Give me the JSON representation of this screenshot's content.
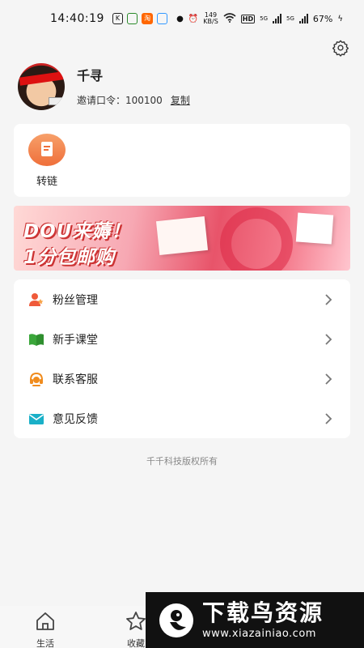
{
  "status_bar": {
    "time": "14:40:19",
    "net_speed": "149",
    "net_unit": "KB/S",
    "hd": "HD",
    "sim1": "5G",
    "sim2": "5G",
    "battery": "67%"
  },
  "profile": {
    "username": "千寻",
    "invite_label": "邀请口令：100100",
    "copy_label": "复制"
  },
  "tools": [
    {
      "label": "转链",
      "icon": "document-icon",
      "color": "#ef6f3a"
    }
  ],
  "banner": {
    "line1": "DOU来薅！",
    "line2": "1分包邮购"
  },
  "menu": [
    {
      "label": "粉丝管理",
      "icon": "fans-icon",
      "color": "#ef5a3a"
    },
    {
      "label": "新手课堂",
      "icon": "book-icon",
      "color": "#3aa63a"
    },
    {
      "label": "联系客服",
      "icon": "headset-icon",
      "color": "#f08c1e"
    },
    {
      "label": "意见反馈",
      "icon": "mail-icon",
      "color": "#1ab0c8"
    }
  ],
  "copyright": "千千科技版权所有",
  "tabbar": [
    {
      "label": "生活",
      "icon": "home-icon"
    },
    {
      "label": "收藏",
      "icon": "star-icon"
    }
  ],
  "watermark": {
    "title": "下载鸟资源",
    "url": "www.xiazainiao.com"
  }
}
